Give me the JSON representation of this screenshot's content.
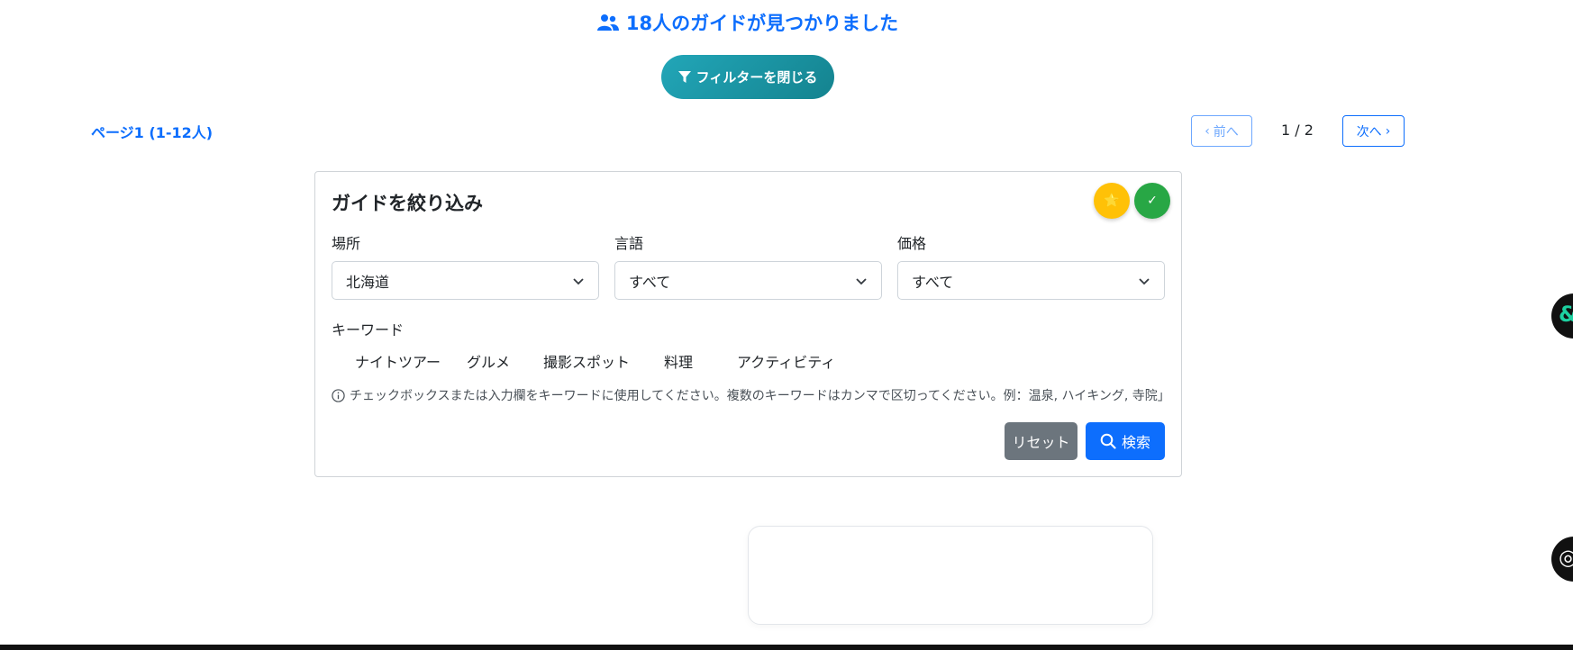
{
  "header": {
    "results_text": "18人のガイドが見つかりました",
    "results_icon": "users-icon",
    "filter_toggle_label": "フィルターを閉じる",
    "filter_toggle_icon": "filter-icon"
  },
  "pagination": {
    "page_info": "ページ1 (1-12人)",
    "prev_label": "前へ",
    "next_label": "次へ",
    "page_count": "1 / 2"
  },
  "filter_card": {
    "title": "ガイドを絞り込み",
    "fab_star_icon": "⭐",
    "fab_check_icon": "✓",
    "location": {
      "label": "場所",
      "value": "北海道"
    },
    "language": {
      "label": "言語",
      "value": "すべて"
    },
    "price": {
      "label": "価格",
      "value": "すべて"
    },
    "keyword_label": "キーワード",
    "keywords": [
      "ナイトツアー",
      "グルメ",
      "撮影スポット",
      "料理",
      "アクティビティ"
    ],
    "hint": "チェックボックスまたは入力欄をキーワードに使用してください。複数のキーワードはカンマで区切ってください。例：温泉, ハイキング, 寺院」",
    "reset_label": "リセット",
    "search_label": "検索"
  },
  "colors": {
    "primary": "#0d6efd",
    "teal": "#1a95a5",
    "secondary": "#6c757d",
    "warning": "#ffc107",
    "success": "#28a745"
  }
}
